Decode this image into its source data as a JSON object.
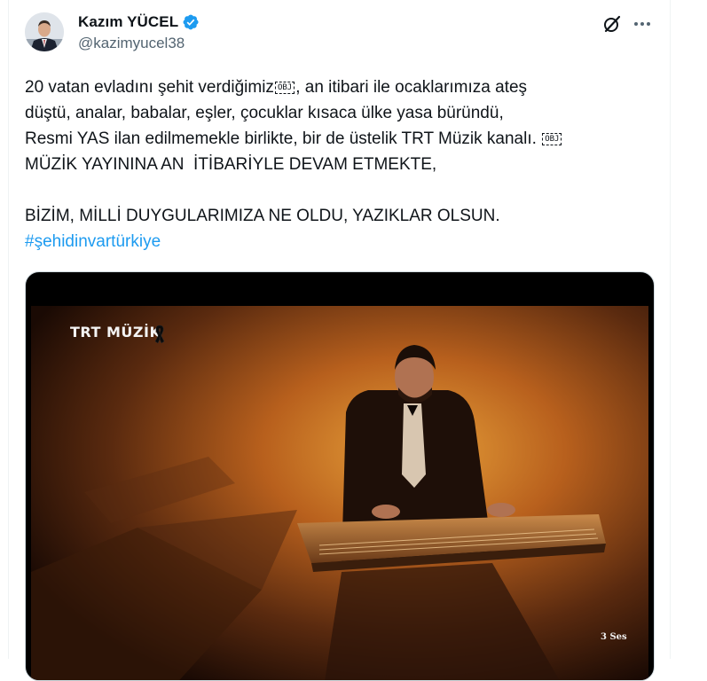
{
  "author": {
    "display_name": "Kazım YÜCEL",
    "handle": "@kazimyucel38",
    "verified": true,
    "avatar_icon": "profile-photo"
  },
  "actions": {
    "grok_icon": "grok-icon",
    "more_icon": "more-icon"
  },
  "tweet": {
    "line1_pre": "20 vatan evladını şehit verdiğimiz",
    "line1_post": ", an itibari ile ocaklarımıza ateş",
    "line2": "düştü, analar, babalar, eşler, çocuklar kısaca ülke yasa büründü,",
    "line3": "Resmi YAS ilan edilmemekle birlikte, bir de üstelik TRT Müzik kanalı. ",
    "line4": "MÜZİK YAYININA AN  İTİBARİYLE DEVAM ETMEKTE,",
    "line5": "BİZİM, MİLLİ DUYGULARIMIZA NE OLDU, YAZIKLAR OLSUN.",
    "hashtag": "#şehidinvartürkiye",
    "obj_glyph": "OBJ"
  },
  "media": {
    "channel_logo": "TRT MÜZİK",
    "voice_label": "3 Ses",
    "mourning_icon": "black-ribbon-icon"
  },
  "colors": {
    "link": "#1d9bf0",
    "verified": "#1d9bf0",
    "secondary_text": "#536471",
    "border": "#cfd9de"
  }
}
